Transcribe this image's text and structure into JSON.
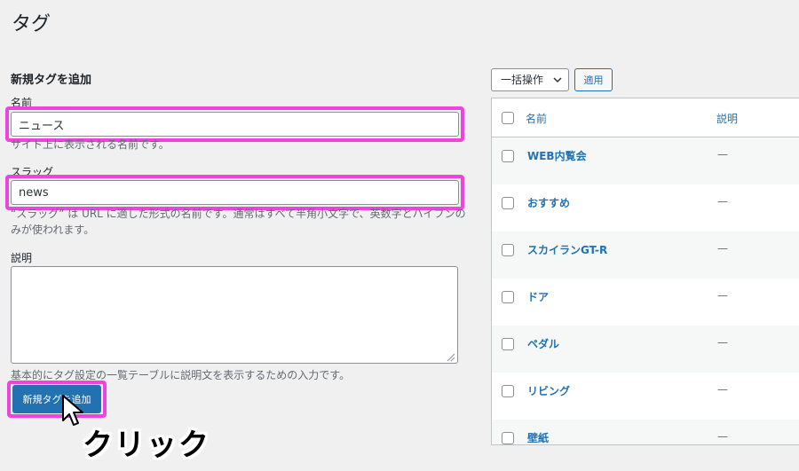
{
  "page": {
    "title": "タグ"
  },
  "form": {
    "section_title": "新規タグを追加",
    "name": {
      "label": "名前",
      "value": "ニュース",
      "help": "サイト上に表示される名前です。"
    },
    "slug": {
      "label": "スラッグ",
      "value": "news",
      "help_line1": "“スラッグ” は URL に適した形式の名前です。通常はすべて半角小文字で、英数字とハイフンの",
      "help_line2": "みが使われます。"
    },
    "description": {
      "label": "説明",
      "value": "",
      "help": "基本的にタグ設定の一覧テーブルに説明文を表示するための入力です。"
    },
    "submit_label": "新規タグを追加"
  },
  "annotation": {
    "click_text": "クリック",
    "highlight_color": "#ee44dd"
  },
  "bulk": {
    "selected": "一括操作",
    "apply_label": "適用"
  },
  "table": {
    "col_name": "名前",
    "col_description": "説明",
    "rows": [
      {
        "name": "WEB内覧会",
        "description": "—"
      },
      {
        "name": "おすすめ",
        "description": "—"
      },
      {
        "name": "スカイランGT-R",
        "description": "—"
      },
      {
        "name": "ドア",
        "description": "—"
      },
      {
        "name": "ペダル",
        "description": "—"
      },
      {
        "name": "リビング",
        "description": "—"
      },
      {
        "name": "壁紙",
        "description": "—"
      }
    ]
  },
  "colors": {
    "accent": "#2271b1",
    "background": "#f0f0f1"
  }
}
